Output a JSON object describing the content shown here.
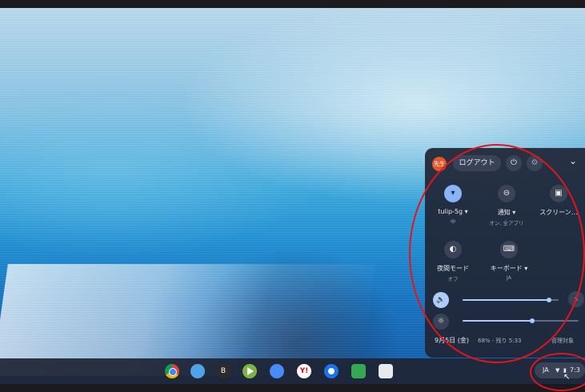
{
  "panel": {
    "avatar_label": "先生",
    "logout_label": "ログアウト",
    "power_icon": "⏻",
    "gear_icon": "⚙",
    "collapse_icon": "⌄",
    "tiles": [
      {
        "icon": "▾",
        "label": "tulip-5g ▾",
        "sub": "中"
      },
      {
        "icon": "⊖",
        "label": "通知 ▾",
        "sub": "オン, 全アプリ"
      },
      {
        "icon": "▣",
        "label": "スクリーン…",
        "sub": ""
      },
      {
        "icon": "◐",
        "label": "夜間モード",
        "sub": "オフ"
      },
      {
        "icon": "⌨",
        "label": "キーボード ▾",
        "sub": "JA"
      }
    ],
    "volume": {
      "level": 0.9,
      "arrow": "›"
    },
    "brightness": {
      "level": 0.6
    },
    "footer": {
      "date": "9月5日 (金)",
      "battery": "68% - 残り 5:33",
      "managed": "管理対象"
    }
  },
  "tray": {
    "ime": "JA",
    "time": "7:3"
  }
}
